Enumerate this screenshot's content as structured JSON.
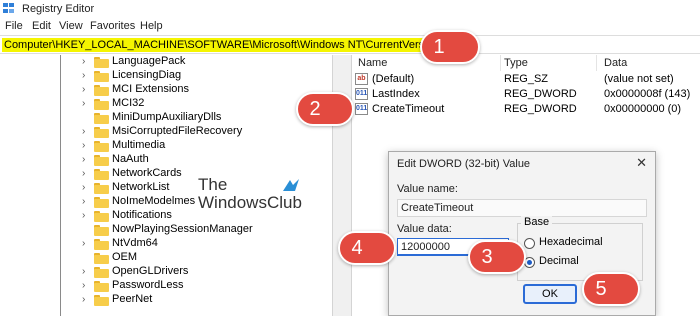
{
  "window": {
    "title": "Registry Editor"
  },
  "menu": [
    "File",
    "Edit",
    "View",
    "Favorites",
    "Help"
  ],
  "address": "Computer\\HKEY_LOCAL_MACHINE\\SOFTWARE\\Microsoft\\Windows NT\\CurrentVersion\\SPP",
  "tree": {
    "items": [
      "LanguagePack",
      "LicensingDiag",
      "MCI Extensions",
      "MCI32",
      "MiniDumpAuxiliaryDlls",
      "MsiCorruptedFileRecovery",
      "Multimedia",
      "NaAuth",
      "NetworkCards",
      "NetworkList",
      "NoImeModelmes",
      "Notifications",
      "NowPlayingSessionManager",
      "NtVdm64",
      "OEM",
      "OpenGLDrivers",
      "PasswordLess",
      "PeerNet"
    ]
  },
  "values": {
    "headers": {
      "name": "Name",
      "type": "Type",
      "data": "Data"
    },
    "rows": [
      {
        "name": "(Default)",
        "type": "REG_SZ",
        "data": "(value not set)",
        "icon": "string-value-icon"
      },
      {
        "name": "LastIndex",
        "type": "REG_DWORD",
        "data": "0x0000008f (143)",
        "icon": "dword-value-icon"
      },
      {
        "name": "CreateTimeout",
        "type": "REG_DWORD",
        "data": "0x00000000 (0)",
        "icon": "dword-value-icon"
      }
    ]
  },
  "watermark": {
    "line1": "The",
    "line2": "WindowsClub"
  },
  "dialog": {
    "title": "Edit DWORD (32-bit) Value",
    "close": "✕",
    "value_name_label": "Value name:",
    "value_name": "CreateTimeout",
    "value_data_label": "Value data:",
    "value_data": "12000000",
    "base_label": "Base",
    "hexadecimal_label": "Hexadecimal",
    "decimal_label": "Decimal",
    "ok_label": "OK",
    "selected_base": "Decimal"
  },
  "callouts": [
    "1",
    "2",
    "3",
    "4",
    "5"
  ],
  "colors": {
    "callout": "#e34a40",
    "address_highlight": "#f5f500",
    "accent": "#2b6bd6"
  }
}
